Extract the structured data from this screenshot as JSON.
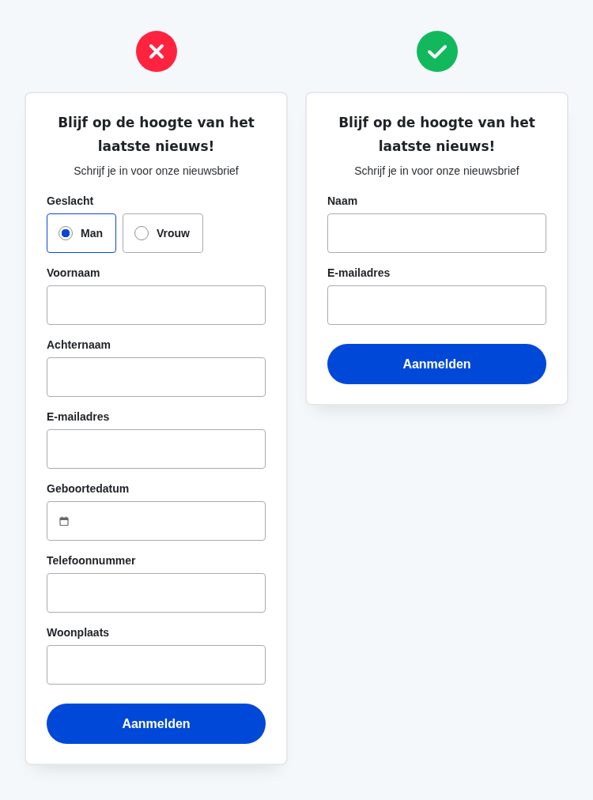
{
  "panels": [
    {
      "kind": "bad",
      "title": "Blijf op de hoogte van het laatste nieuws!",
      "subtitle": "Schrijf je in voor onze nieuwsbrief",
      "fields": [
        {
          "kind": "radio",
          "label": "Geslacht",
          "options": [
            {
              "label": "Man",
              "selected": true
            },
            {
              "label": "Vrouw",
              "selected": false
            }
          ]
        },
        {
          "kind": "text",
          "label": "Voornaam"
        },
        {
          "kind": "text",
          "label": "Achternaam"
        },
        {
          "kind": "text",
          "label": "E-mailadres"
        },
        {
          "kind": "date",
          "label": "Geboortedatum"
        },
        {
          "kind": "text",
          "label": "Telefoonnummer"
        },
        {
          "kind": "text",
          "label": "Woonplaats"
        }
      ],
      "button": "Aanmelden"
    },
    {
      "kind": "good",
      "title": "Blijf op de hoogte van het laatste nieuws!",
      "subtitle": "Schrijf je in voor onze nieuwsbrief",
      "fields": [
        {
          "kind": "text",
          "label": "Naam"
        },
        {
          "kind": "text",
          "label": "E-mailadres"
        }
      ],
      "button": "Aanmelden"
    }
  ]
}
